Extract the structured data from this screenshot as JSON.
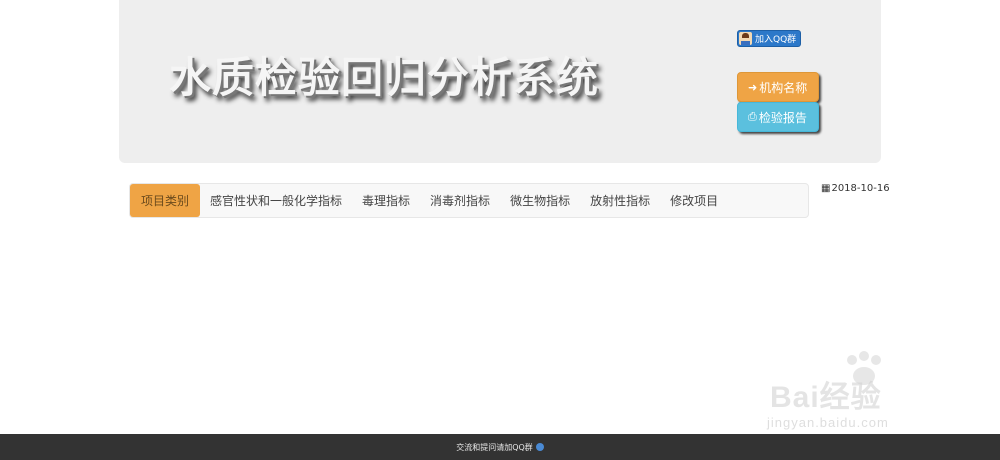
{
  "header": {
    "title": "水质检验回归分析系统",
    "qq_badge": "加入QQ群",
    "btn_org": "机构名称",
    "btn_report": "检验报告"
  },
  "nav": {
    "items": [
      {
        "label": "项目类别",
        "active": true
      },
      {
        "label": "感官性状和一般化学指标"
      },
      {
        "label": "毒理指标"
      },
      {
        "label": "消毒剂指标"
      },
      {
        "label": "微生物指标"
      },
      {
        "label": "放射性指标"
      },
      {
        "label": "修改项目"
      }
    ]
  },
  "date": "2018-10-16",
  "footer": {
    "text": "交流和提问请加QQ群"
  },
  "watermark": {
    "brand": "Bai经验",
    "url": "jingyan.baidu.com"
  },
  "colors": {
    "accent_orange": "#efa445",
    "accent_blue": "#5bc0de",
    "footer_bg": "#333333"
  }
}
